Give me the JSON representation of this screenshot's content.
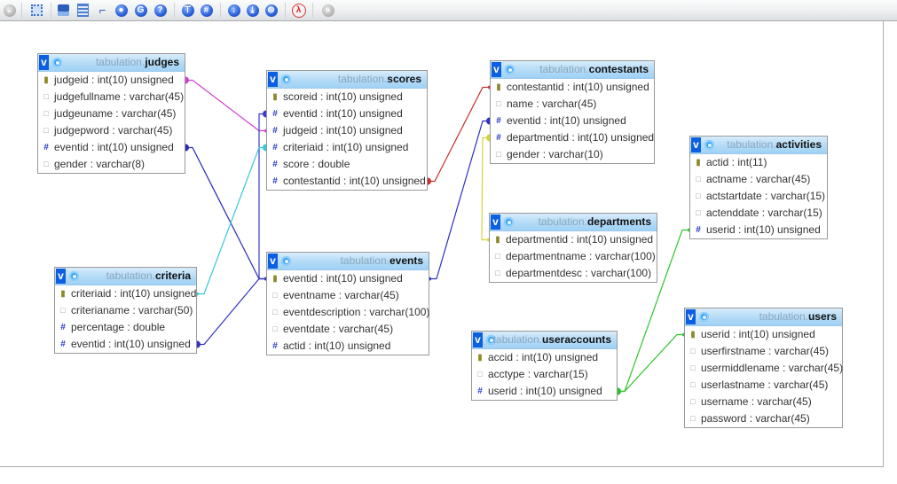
{
  "toolbar": {
    "buttons": [
      {
        "name": "toggle-menu-icon"
      },
      {
        "name": "fullscreen-icon"
      },
      {
        "name": "save-icon"
      },
      {
        "name": "list-icon"
      },
      {
        "name": "relation-line-icon"
      },
      {
        "name": "angular-links-icon"
      },
      {
        "name": "grid-snap-icon"
      },
      {
        "name": "help-icon"
      },
      {
        "name": "toggle-all-icon"
      },
      {
        "name": "small-big-icon"
      },
      {
        "name": "show-hide-icon"
      },
      {
        "name": "move-icon"
      },
      {
        "name": "collapse-icon"
      },
      {
        "name": "export-pdf-icon"
      },
      {
        "name": "next-icon"
      }
    ]
  },
  "database": "tabulation.",
  "tables": [
    {
      "id": "judges",
      "name": "judges",
      "columns": [
        {
          "type": "key",
          "text": "judgeid : int(10) unsigned"
        },
        {
          "type": "col",
          "text": "judgefullname : varchar(45)"
        },
        {
          "type": "col",
          "text": "judgeuname : varchar(45)"
        },
        {
          "type": "col",
          "text": "judgepword : varchar(45)"
        },
        {
          "type": "fk",
          "text": "eventid : int(10) unsigned"
        },
        {
          "type": "col",
          "text": "gender : varchar(8)"
        }
      ]
    },
    {
      "id": "scores",
      "name": "scores",
      "columns": [
        {
          "type": "key",
          "text": "scoreid : int(10) unsigned"
        },
        {
          "type": "fk",
          "text": "eventid : int(10) unsigned"
        },
        {
          "type": "fk",
          "text": "judgeid : int(10) unsigned"
        },
        {
          "type": "fk",
          "text": "criteriaid : int(10) unsigned"
        },
        {
          "type": "fk",
          "text": "score : double"
        },
        {
          "type": "fk",
          "text": "contestantid : int(10) unsigned"
        }
      ]
    },
    {
      "id": "contestants",
      "name": "contestants",
      "columns": [
        {
          "type": "key",
          "text": "contestantid : int(10) unsigned"
        },
        {
          "type": "col",
          "text": "name : varchar(45)"
        },
        {
          "type": "fk",
          "text": "eventid : int(10) unsigned"
        },
        {
          "type": "fk",
          "text": "departmentid : int(10) unsigned"
        },
        {
          "type": "col",
          "text": "gender : varchar(10)"
        }
      ]
    },
    {
      "id": "activities",
      "name": "activities",
      "columns": [
        {
          "type": "key",
          "text": "actid : int(11)"
        },
        {
          "type": "col",
          "text": "actname : varchar(45)"
        },
        {
          "type": "col",
          "text": "actstartdate : varchar(15)"
        },
        {
          "type": "col",
          "text": "actenddate : varchar(15)"
        },
        {
          "type": "fk",
          "text": "userid : int(10) unsigned"
        }
      ]
    },
    {
      "id": "departments",
      "name": "departments",
      "columns": [
        {
          "type": "key",
          "text": "departmentid : int(10) unsigned"
        },
        {
          "type": "col",
          "text": "departmentname : varchar(100)"
        },
        {
          "type": "col",
          "text": "departmentdesc : varchar(100)"
        }
      ]
    },
    {
      "id": "criteria",
      "name": "criteria",
      "columns": [
        {
          "type": "key",
          "text": "criteriaid : int(10) unsigned"
        },
        {
          "type": "col",
          "text": "criterianame : varchar(50)"
        },
        {
          "type": "fk",
          "text": "percentage : double"
        },
        {
          "type": "fk",
          "text": "eventid : int(10) unsigned"
        }
      ]
    },
    {
      "id": "events",
      "name": "events",
      "columns": [
        {
          "type": "key",
          "text": "eventid : int(10) unsigned"
        },
        {
          "type": "col",
          "text": "eventname : varchar(45)"
        },
        {
          "type": "col",
          "text": "eventdescription : varchar(100)"
        },
        {
          "type": "col",
          "text": "eventdate : varchar(45)"
        },
        {
          "type": "fk",
          "text": "actid : int(10) unsigned"
        }
      ]
    },
    {
      "id": "useraccounts",
      "name": "useraccounts",
      "columns": [
        {
          "type": "key",
          "text": "accid : int(10) unsigned"
        },
        {
          "type": "col",
          "text": "acctype : varchar(15)"
        },
        {
          "type": "fk",
          "text": "userid : int(10) unsigned"
        }
      ]
    },
    {
      "id": "users",
      "name": "users",
      "columns": [
        {
          "type": "key",
          "text": "userid : int(10) unsigned"
        },
        {
          "type": "col",
          "text": "userfirstname : varchar(45)"
        },
        {
          "type": "col",
          "text": "usermiddlename : varchar(45)"
        },
        {
          "type": "col",
          "text": "userlastname : varchar(45)"
        },
        {
          "type": "col",
          "text": "username : varchar(45)"
        },
        {
          "type": "col",
          "text": "password : varchar(45)"
        }
      ]
    }
  ],
  "relations": [
    {
      "from": "judges.judgeid",
      "to": "scores.judgeid",
      "color": "#d23fd2"
    },
    {
      "from": "judges.eventid",
      "to": "events.eventid",
      "color": "#2a2ab5"
    },
    {
      "from": "scores.eventid",
      "to": "events.eventid",
      "color": "#3a3ad0"
    },
    {
      "from": "scores.criteriaid",
      "to": "criteria.criteriaid",
      "color": "#36c9d6"
    },
    {
      "from": "criteria.eventid",
      "to": "events.eventid",
      "color": "#3434c0"
    },
    {
      "from": "scores.contestantid",
      "to": "contestants.contestantid",
      "color": "#c43030"
    },
    {
      "from": "contestants.eventid",
      "to": "events.eventid",
      "color": "#3030c8"
    },
    {
      "from": "contestants.departmentid",
      "to": "departments.departmentid",
      "color": "#d8d23a"
    },
    {
      "from": "useraccounts.userid",
      "to": "activities.userid",
      "color": "#2ec42e"
    },
    {
      "from": "useraccounts.userid",
      "to": "users.userid",
      "color": "#2ec42e"
    }
  ]
}
